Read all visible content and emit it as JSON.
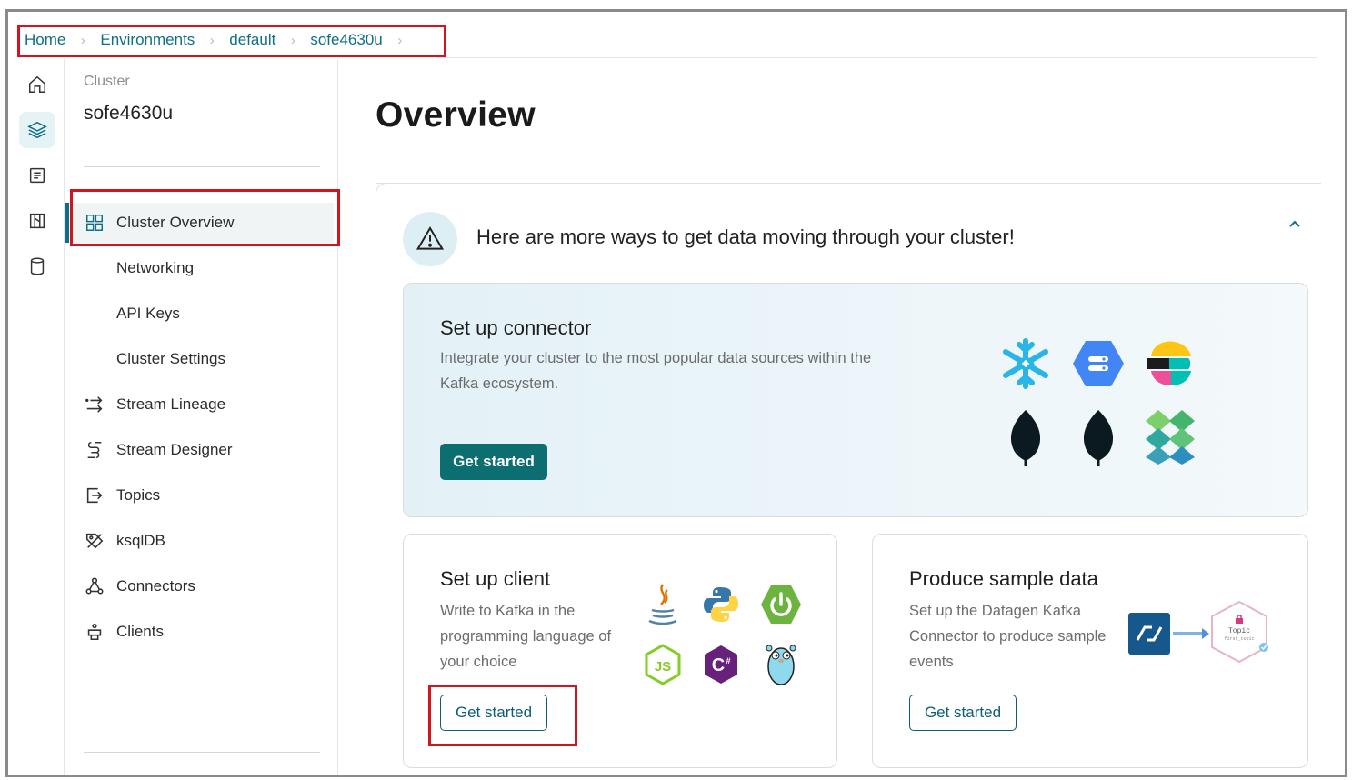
{
  "breadcrumb": {
    "items": [
      "Home",
      "Environments",
      "default",
      "sofe4630u"
    ]
  },
  "rail": {
    "icons": [
      "home-icon",
      "layers-icon",
      "document-icon",
      "map-icon",
      "database-icon"
    ]
  },
  "nav": {
    "subtitle": "Cluster",
    "cluster_name": "sofe4630u",
    "items": [
      {
        "label": "Cluster Overview",
        "icon": "grid-icon"
      },
      {
        "label": "Networking"
      },
      {
        "label": "API Keys"
      },
      {
        "label": "Cluster Settings"
      },
      {
        "label": "Stream Lineage",
        "icon": "stream-lineage-icon"
      },
      {
        "label": "Stream Designer",
        "icon": "stream-designer-icon"
      },
      {
        "label": "Topics",
        "icon": "topics-icon"
      },
      {
        "label": "ksqlDB",
        "icon": "ksqldb-icon"
      },
      {
        "label": "Connectors",
        "icon": "connectors-icon"
      },
      {
        "label": "Clients",
        "icon": "clients-icon"
      }
    ]
  },
  "main": {
    "title": "Overview",
    "headline": "Here are more ways to get data moving through your cluster!",
    "connector_card": {
      "title": "Set up connector",
      "desc_line1": "Integrate your cluster to the most popular data sources within the",
      "desc_line2": "Kafka ecosystem.",
      "button": "Get started"
    },
    "client_card": {
      "title": "Set up client",
      "desc_line1": "Write to Kafka in the",
      "desc_line2": "programming language of",
      "desc_line3": "your choice",
      "button": "Get started"
    },
    "sample_card": {
      "title": "Produce sample data",
      "desc_line1": "Set up the Datagen Kafka",
      "desc_line2": "Connector to produce sample",
      "desc_line3": "events",
      "button": "Get started",
      "topic_label": "Topic",
      "topic_sub": "first_topic"
    }
  },
  "colors": {
    "accent": "#0d6e86",
    "button": "#0d6e72",
    "highlight": "#d1141e"
  }
}
